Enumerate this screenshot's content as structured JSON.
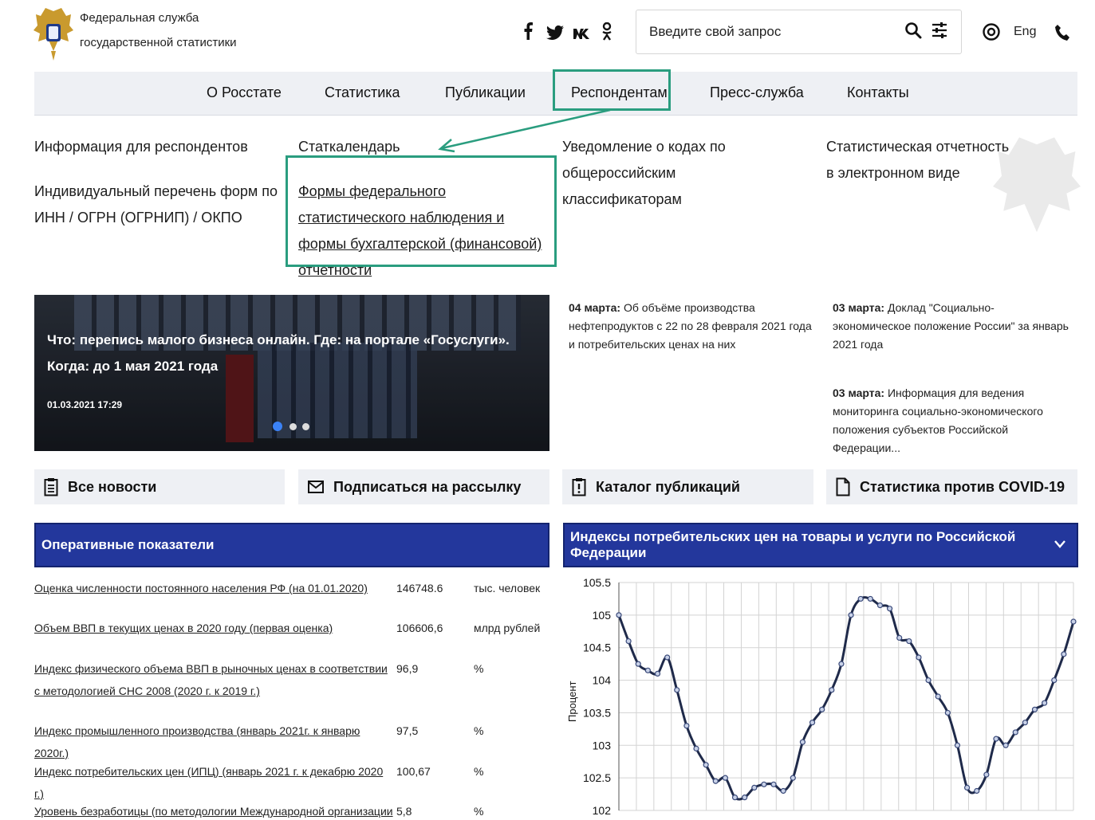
{
  "header": {
    "org_line1": "Федеральная служба",
    "org_line2": "государственной статистики",
    "social": [
      "f",
      "twitter",
      "vk",
      "ok"
    ],
    "search_placeholder": "Введите свой запрос",
    "lang": "Eng"
  },
  "nav": {
    "items": [
      "О Росстате",
      "Статистика",
      "Публикации",
      "Респондентам",
      "Пресс-служба",
      "Контакты"
    ],
    "active": "Респондентам"
  },
  "dropdown": {
    "col1": [
      "Информация для респондентов",
      "Индивидуальный перечень форм по ИНН / ОГРН (ОГРНИП) / ОКПО"
    ],
    "col2": [
      "Статкалендарь",
      "Формы федерального статистического наблюдения и формы бухгалтерской (финансовой) отчетности"
    ],
    "col3": [
      "Уведомление о кодах по общероссийским классификаторам"
    ],
    "col4": [
      "Статистическая отчетность в электронном виде"
    ]
  },
  "slider": {
    "headline": "Что: перепись малого бизнеса онлайн. Где: на портале «Госуслуги». Когда: до 1 мая 2021 года",
    "date": "01.03.2021 17:29"
  },
  "news": [
    {
      "date": "04 марта:",
      "text": "Об объёме производства нефтепродуктов с 22 по 28 февраля 2021 года и потребительских ценах на них"
    },
    {
      "date": "03 марта:",
      "text": "Доклад \"Социально-экономическое положение России\" за январь 2021 года"
    },
    {
      "date": "03 марта:",
      "text": "Информация для ведения мониторинга социально-экономического положения субъектов Российской Федерации..."
    }
  ],
  "quick_links": [
    "Все новости",
    "Подписаться на рассылку",
    "Каталог публикаций",
    "Статистика против COVID-19"
  ],
  "indicators": {
    "title": "Оперативные показатели",
    "rows": [
      {
        "name": "Оценка численности постоянного населения РФ (на 01.01.2020)",
        "value": "146748.6",
        "unit": "тыс. человек"
      },
      {
        "name": "Объем ВВП в текущих ценах в 2020 году (первая оценка)",
        "value": "106606,6",
        "unit": "млрд рублей"
      },
      {
        "name": "Индекс физического объема ВВП в рыночных ценах в соответствии с методологией СНС 2008 (2020 г. к 2019 г.)",
        "value": "96,9",
        "unit": "%"
      },
      {
        "name": "Индекс промышленного производства (январь 2021г. к январю 2020г.)",
        "value": "97,5",
        "unit": "%"
      },
      {
        "name": "Индекс потребительских цен (ИПЦ) (январь 2021 г. к декабрю 2020 г.)",
        "value": "100,67",
        "unit": "%"
      },
      {
        "name": "Уровень безработицы (по методологии Международной организации",
        "value": "5,8",
        "unit": "%"
      }
    ]
  },
  "chart_data": {
    "type": "line",
    "title": "Индексы потребительских цен на товары и услуги по Российской Федерации",
    "ylabel": "Процент",
    "ylim": [
      102,
      105.5
    ],
    "yticks": [
      "102",
      "102.5",
      "103",
      "103.5",
      "104",
      "104.5",
      "105",
      "105.5"
    ],
    "grid": true,
    "line_color": "#1f2a4a",
    "series": [
      {
        "values": [
          105.0,
          104.6,
          104.25,
          104.15,
          104.1,
          104.35,
          103.85,
          103.3,
          102.95,
          102.7,
          102.45,
          102.5,
          102.2,
          102.2,
          102.35,
          102.4,
          102.4,
          102.3,
          102.5,
          103.05,
          103.35,
          103.55,
          103.85,
          104.25,
          105.0,
          105.25,
          105.25,
          105.15,
          105.1,
          104.65,
          104.6,
          104.35,
          104.0,
          103.75,
          103.5,
          103.0,
          102.35,
          102.3,
          102.55,
          103.1,
          103.0,
          103.2,
          103.35,
          103.55,
          103.65,
          104.0,
          104.4,
          104.9
        ]
      }
    ]
  }
}
